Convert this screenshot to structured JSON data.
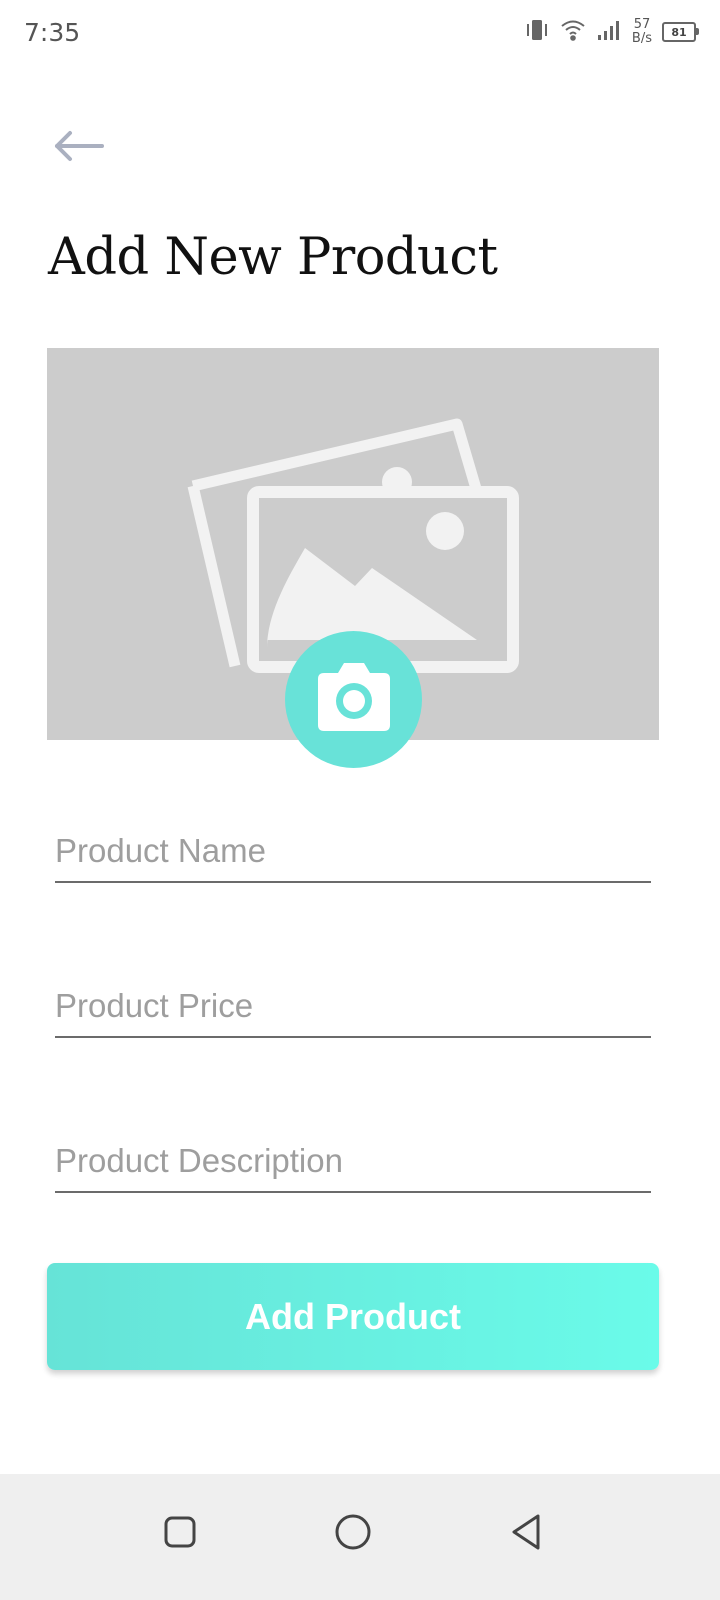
{
  "status_bar": {
    "time": "7:35",
    "network_speed_value": "57",
    "network_speed_unit": "B/s",
    "battery_level": "81",
    "icons": [
      "vibrate-icon",
      "wifi-icon",
      "signal-icon",
      "battery-icon"
    ]
  },
  "header": {
    "back_icon": "arrow-left-icon",
    "title": "Add New Product"
  },
  "image_picker": {
    "placeholder_icon": "image-placeholder-icon",
    "camera_icon": "camera-icon"
  },
  "form": {
    "product_name": {
      "value": "",
      "placeholder": "Product Name"
    },
    "product_price": {
      "value": "",
      "placeholder": "Product Price"
    },
    "product_description": {
      "value": "",
      "placeholder": "Product Description"
    }
  },
  "actions": {
    "add_product_label": "Add Product"
  },
  "nav_bar": {
    "icons": [
      "recents-icon",
      "home-icon",
      "back-icon"
    ]
  },
  "colors": {
    "accent": "#68e2d8",
    "accent_gradient_end": "#6afbe9",
    "placeholder_bg": "#cccccc",
    "nav_bg": "#efefef"
  }
}
